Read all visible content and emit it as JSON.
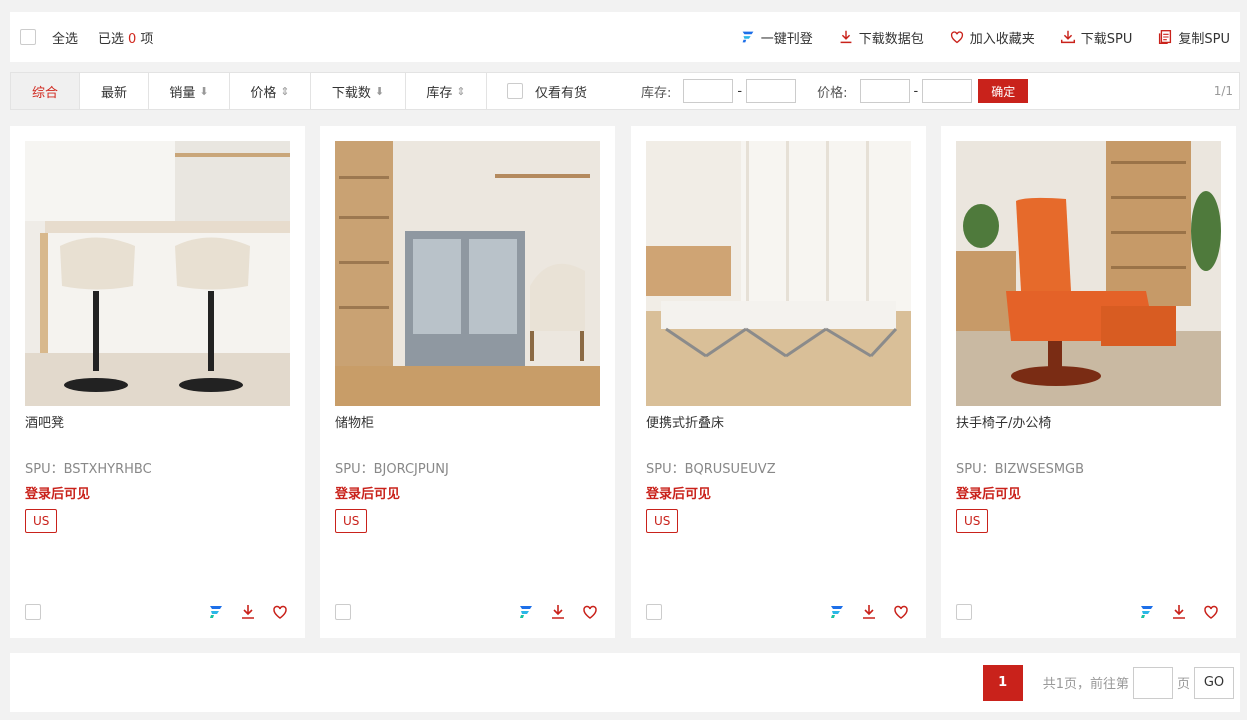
{
  "toolbar": {
    "select_all": "全选",
    "selected_prefix": "已选",
    "selected_count": "0",
    "selected_suffix": "项",
    "actions": [
      {
        "label": "一键刊登",
        "icon": "publish-icon"
      },
      {
        "label": "下载数据包",
        "icon": "download-icon"
      },
      {
        "label": "加入收藏夹",
        "icon": "heart-icon"
      },
      {
        "label": "下载SPU",
        "icon": "download-icon"
      },
      {
        "label": "复制SPU",
        "icon": "copy-icon"
      }
    ]
  },
  "filters": {
    "tabs": [
      {
        "label": "综合"
      },
      {
        "label": "最新"
      },
      {
        "label": "销量"
      },
      {
        "label": "价格"
      },
      {
        "label": "下载数"
      },
      {
        "label": "库存"
      }
    ],
    "in_stock": "仅看有货",
    "stock_label": "库存:",
    "price_label": "价格:",
    "confirm": "确定",
    "page_info": "1/1"
  },
  "products": [
    {
      "name": "酒吧凳",
      "spu": "SPU：BSTXHYRHBC",
      "login": "登录后可见",
      "tag": "US"
    },
    {
      "name": "储物柜",
      "spu": "SPU：BJORCJPUNJ",
      "login": "登录后可见",
      "tag": "US"
    },
    {
      "name": "便携式折叠床",
      "spu": "SPU：BQRUSUEUVZ",
      "login": "登录后可见",
      "tag": "US"
    },
    {
      "name": "扶手椅子/办公椅",
      "spu": "SPU：BIZWSESMGB",
      "login": "登录后可见",
      "tag": "US"
    }
  ],
  "pagination": {
    "current": "1",
    "total_text": "共1页，前往第",
    "page_unit": "页",
    "go": "GO"
  },
  "colors": {
    "accent": "#c9221b",
    "brand_blue": "#1d6fe8"
  }
}
